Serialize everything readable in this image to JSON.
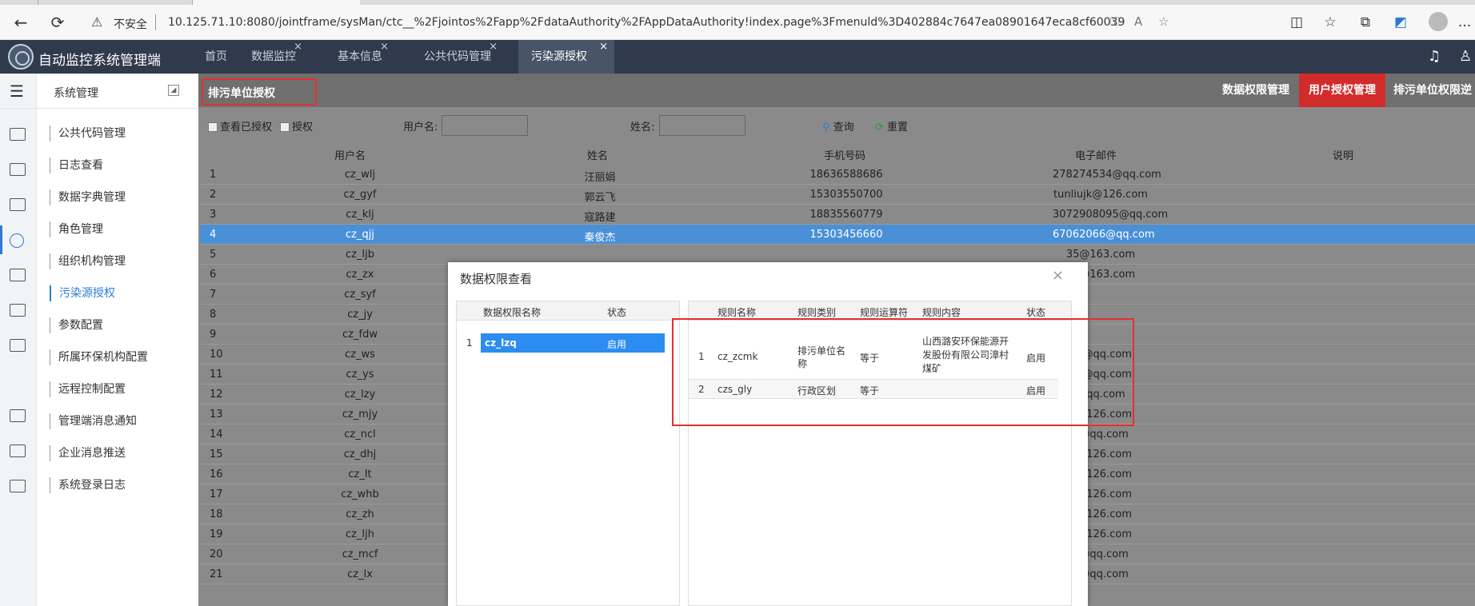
{
  "browser": {
    "insecure_label": "不安全",
    "url": "10.125.71.10:8080/jointframe/sysMan/ctc__%2Fjointos%2Fapp%2FdataAuthority%2FAppDataAuthority!index.page%3Fmenuld%3D402884c7647ea08901647eca8cf60039",
    "more_label": "..."
  },
  "app": {
    "title": "自动监控系统管理端",
    "nav_tabs": [
      {
        "label": "首页"
      },
      {
        "label": "数据监控"
      },
      {
        "label": "基本信息"
      },
      {
        "label": "公共代码管理"
      },
      {
        "label": "污染源授权"
      }
    ],
    "close_glyph": "×"
  },
  "sidebar": {
    "title": "系统管理",
    "items": [
      {
        "label": "公共代码管理"
      },
      {
        "label": "日志查看"
      },
      {
        "label": "数据字典管理"
      },
      {
        "label": "角色管理"
      },
      {
        "label": "组织机构管理"
      },
      {
        "label": "污染源授权"
      },
      {
        "label": "参数配置"
      },
      {
        "label": "所属环保机构配置"
      },
      {
        "label": "远程控制配置"
      },
      {
        "label": "管理端消息通知"
      },
      {
        "label": "企业消息推送"
      },
      {
        "label": "系统登录日志"
      }
    ]
  },
  "toolbar": {
    "breadcrumb": "排污单位授权",
    "right_tabs": [
      {
        "label": "数据权限管理"
      },
      {
        "label": "用户授权管理"
      },
      {
        "label": "排污单位权限逆"
      }
    ]
  },
  "filter": {
    "view_authorized": "查看已授权",
    "authorize": "授权",
    "username_label": "用户名:",
    "name_label": "姓名:",
    "search": "查询",
    "reset": "重置"
  },
  "grid": {
    "columns": [
      "用户名",
      "姓名",
      "手机号码",
      "电子邮件",
      "说明"
    ],
    "rows": [
      {
        "n": "1",
        "user": "cz_wlj",
        "name": "汪丽娟",
        "phone": "18636588686",
        "email": "278274534@qq.com"
      },
      {
        "n": "2",
        "user": "cz_gyf",
        "name": "郭云飞",
        "phone": "15303550700",
        "email": "tunliujk@126.com"
      },
      {
        "n": "3",
        "user": "cz_klj",
        "name": "寇路建",
        "phone": "18835560779",
        "email": "3072908095@qq.com"
      },
      {
        "n": "4",
        "user": "cz_qjj",
        "name": "秦俊杰",
        "phone": "15303456660",
        "email": "67062066@qq.com"
      },
      {
        "n": "5",
        "user": "cz_ljb",
        "name": "",
        "phone": "",
        "email": "35@163.com"
      },
      {
        "n": "6",
        "user": "cz_zx",
        "name": "",
        "phone": "",
        "email": "13@163.com"
      },
      {
        "n": "7",
        "user": "cz_syf",
        "name": "",
        "phone": "",
        "email": ""
      },
      {
        "n": "8",
        "user": "cz_jy",
        "name": "",
        "phone": "",
        "email": ""
      },
      {
        "n": "9",
        "user": "cz_fdw",
        "name": "",
        "phone": "",
        "email": ""
      },
      {
        "n": "10",
        "user": "cz_ws",
        "name": "",
        "phone": "",
        "email": "34@qq.com"
      },
      {
        "n": "11",
        "user": "cz_ys",
        "name": "",
        "phone": "",
        "email": "08@qq.com"
      },
      {
        "n": "12",
        "user": "cz_lzy",
        "name": "",
        "phone": "",
        "email": "@qq.com"
      },
      {
        "n": "13",
        "user": "cz_mjy",
        "name": "",
        "phone": "",
        "email": "b@126.com"
      },
      {
        "n": "14",
        "user": "cz_ncl",
        "name": "",
        "phone": "",
        "email": "0@qq.com"
      },
      {
        "n": "15",
        "user": "cz_dhj",
        "name": "",
        "phone": "",
        "email": "b@126.com"
      },
      {
        "n": "16",
        "user": "cz_lt",
        "name": "",
        "phone": "",
        "email": "b@126.com"
      },
      {
        "n": "17",
        "user": "cz_whb",
        "name": "",
        "phone": "",
        "email": "b@126.com"
      },
      {
        "n": "18",
        "user": "cz_zh",
        "name": "",
        "phone": "",
        "email": "b@126.com"
      },
      {
        "n": "19",
        "user": "cz_ljh",
        "name": "",
        "phone": "",
        "email": "b@126.com"
      },
      {
        "n": "20",
        "user": "cz_mcf",
        "name": "",
        "phone": "",
        "email": "2@qq.com"
      },
      {
        "n": "21",
        "user": "cz_lx",
        "name": "",
        "phone": "",
        "email": "1@qq.com"
      }
    ]
  },
  "modal": {
    "title": "数据权限查看",
    "close_glyph": "×",
    "left": {
      "columns": [
        "数据权限名称",
        "状态"
      ],
      "rows": [
        {
          "n": "1",
          "name": "cz_lzq",
          "status": "启用"
        }
      ]
    },
    "right": {
      "columns": [
        "规则名称",
        "规则类别",
        "规则运算符",
        "规则内容",
        "状态"
      ],
      "rows": [
        {
          "n": "1",
          "name": "cz_zcmk",
          "type": "排污单位名称",
          "op": "等于",
          "content": "山西潞安环保能源开发股份有限公司漳村煤矿",
          "status": "启用"
        },
        {
          "n": "2",
          "name": "czs_gly",
          "type": "行政区划",
          "op": "等于",
          "content": "",
          "status": "启用"
        }
      ]
    }
  },
  "colors": {
    "header_bg": "#2f3a4c",
    "selected_row": "#4a90d6",
    "highlight_red": "#e53030",
    "active_tab_red": "#d12b2b",
    "primary_blue": "#2b7bd6"
  }
}
